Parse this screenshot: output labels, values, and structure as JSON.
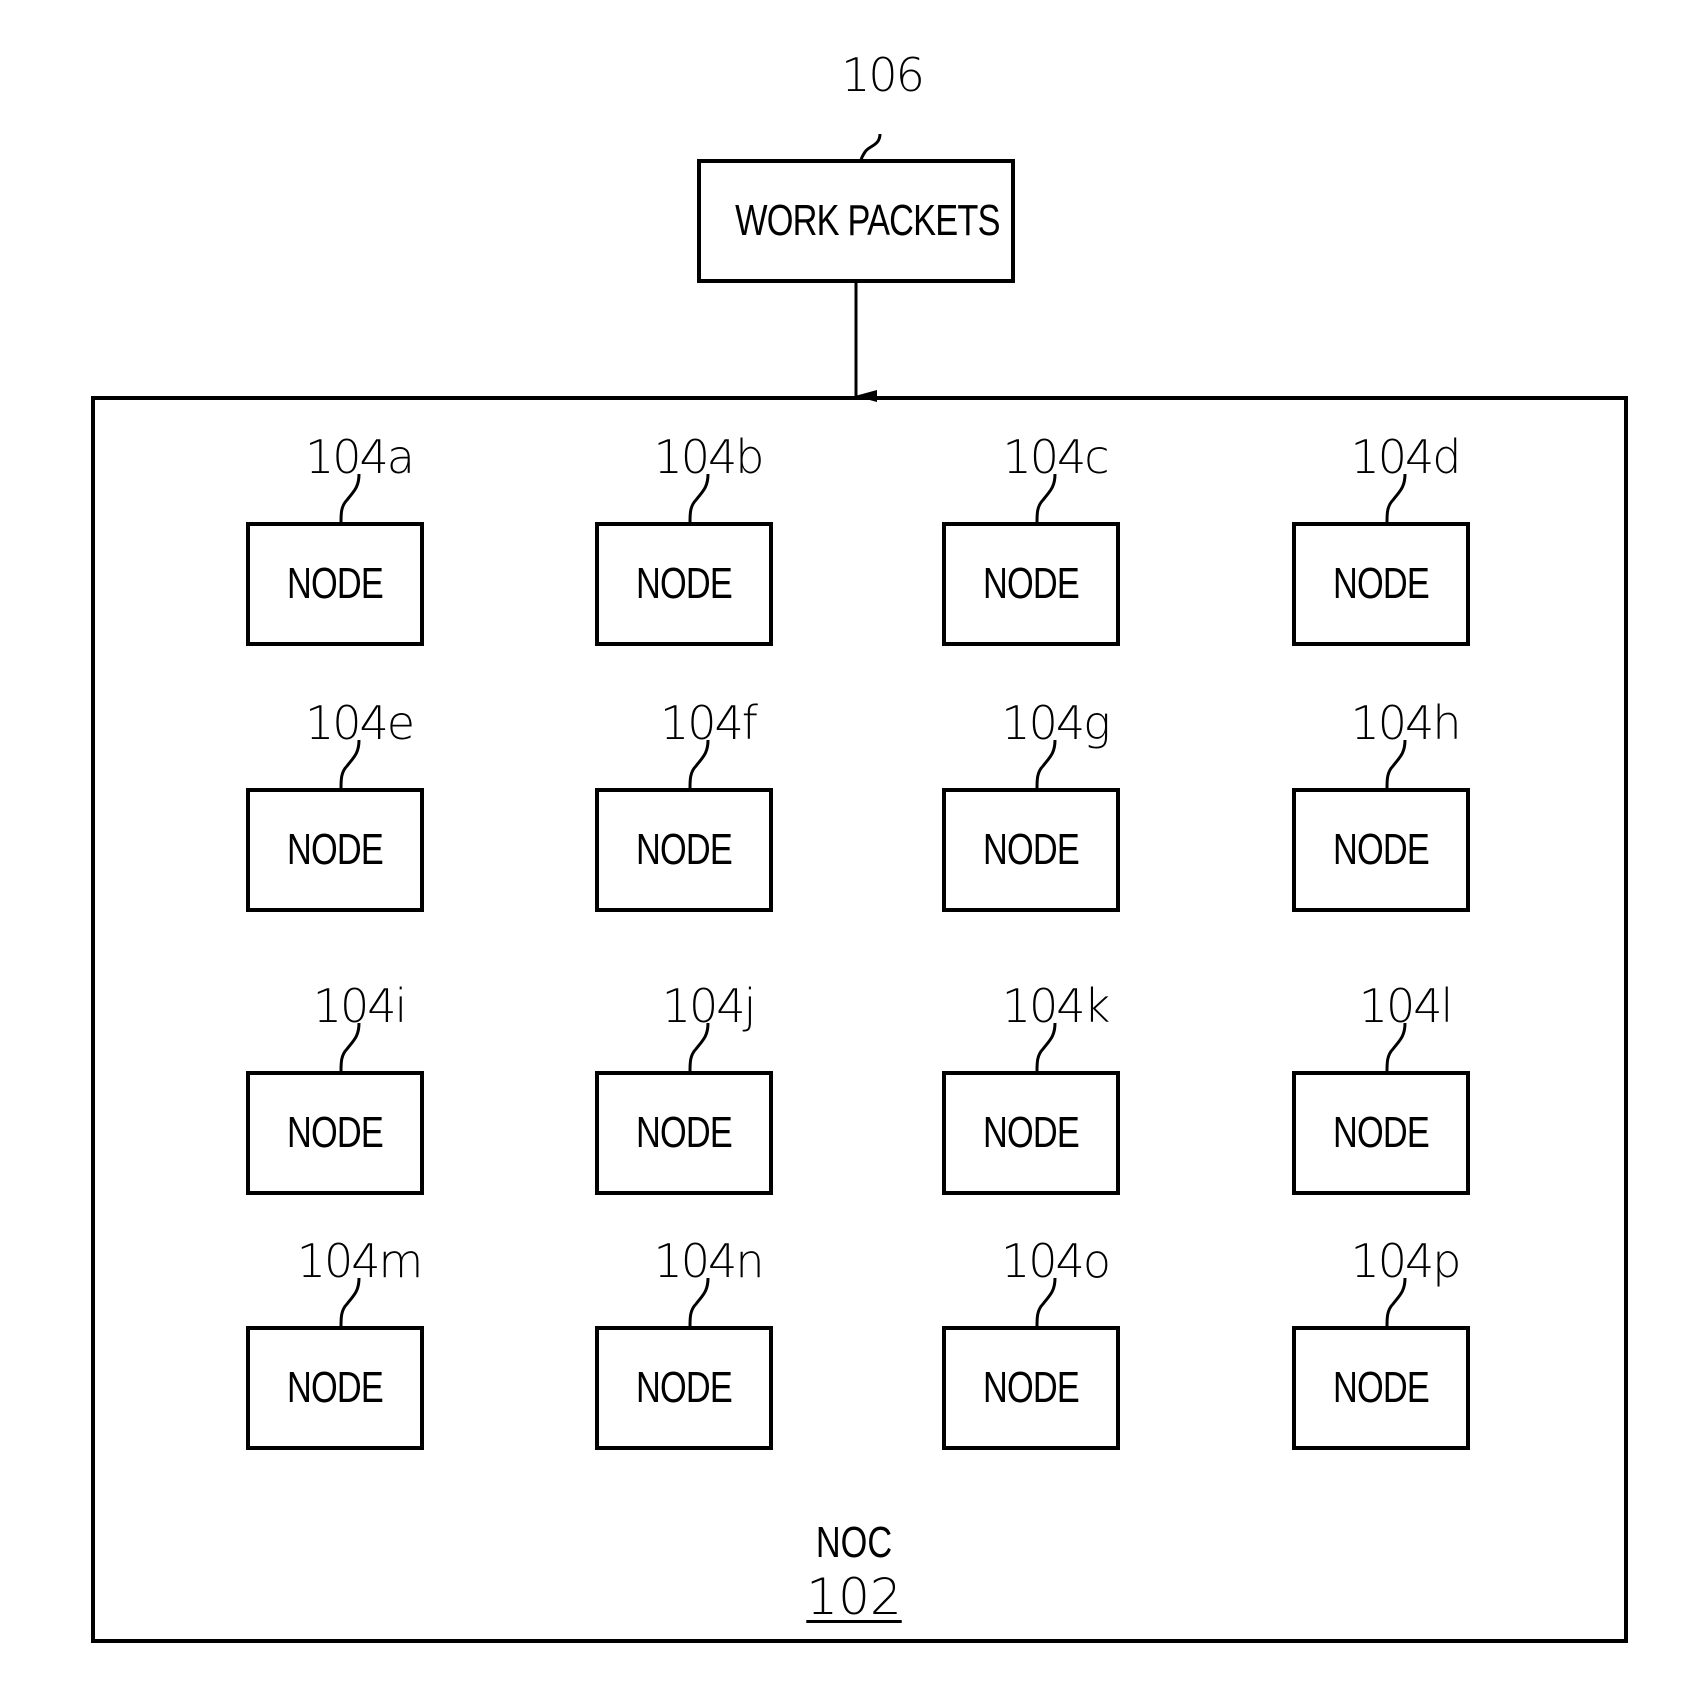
{
  "work_packets": {
    "ref": "106",
    "label": "WORK PACKETS"
  },
  "noc": {
    "label": "NOC",
    "ref": "102"
  },
  "nodes": [
    {
      "ref": "104a",
      "label": "NODE"
    },
    {
      "ref": "104b",
      "label": "NODE"
    },
    {
      "ref": "104c",
      "label": "NODE"
    },
    {
      "ref": "104d",
      "label": "NODE"
    },
    {
      "ref": "104e",
      "label": "NODE"
    },
    {
      "ref": "104f",
      "label": "NODE"
    },
    {
      "ref": "104g",
      "label": "NODE"
    },
    {
      "ref": "104h",
      "label": "NODE"
    },
    {
      "ref": "104i",
      "label": "NODE"
    },
    {
      "ref": "104j",
      "label": "NODE"
    },
    {
      "ref": "104k",
      "label": "NODE"
    },
    {
      "ref": "104l",
      "label": "NODE"
    },
    {
      "ref": "104m",
      "label": "NODE"
    },
    {
      "ref": "104n",
      "label": "NODE"
    },
    {
      "ref": "104o",
      "label": "NODE"
    },
    {
      "ref": "104p",
      "label": "NODE"
    }
  ],
  "grid": {
    "rows": 4,
    "cols": 4
  },
  "connections": [
    {
      "from": "work_packets",
      "to": "noc",
      "type": "arrow"
    }
  ]
}
